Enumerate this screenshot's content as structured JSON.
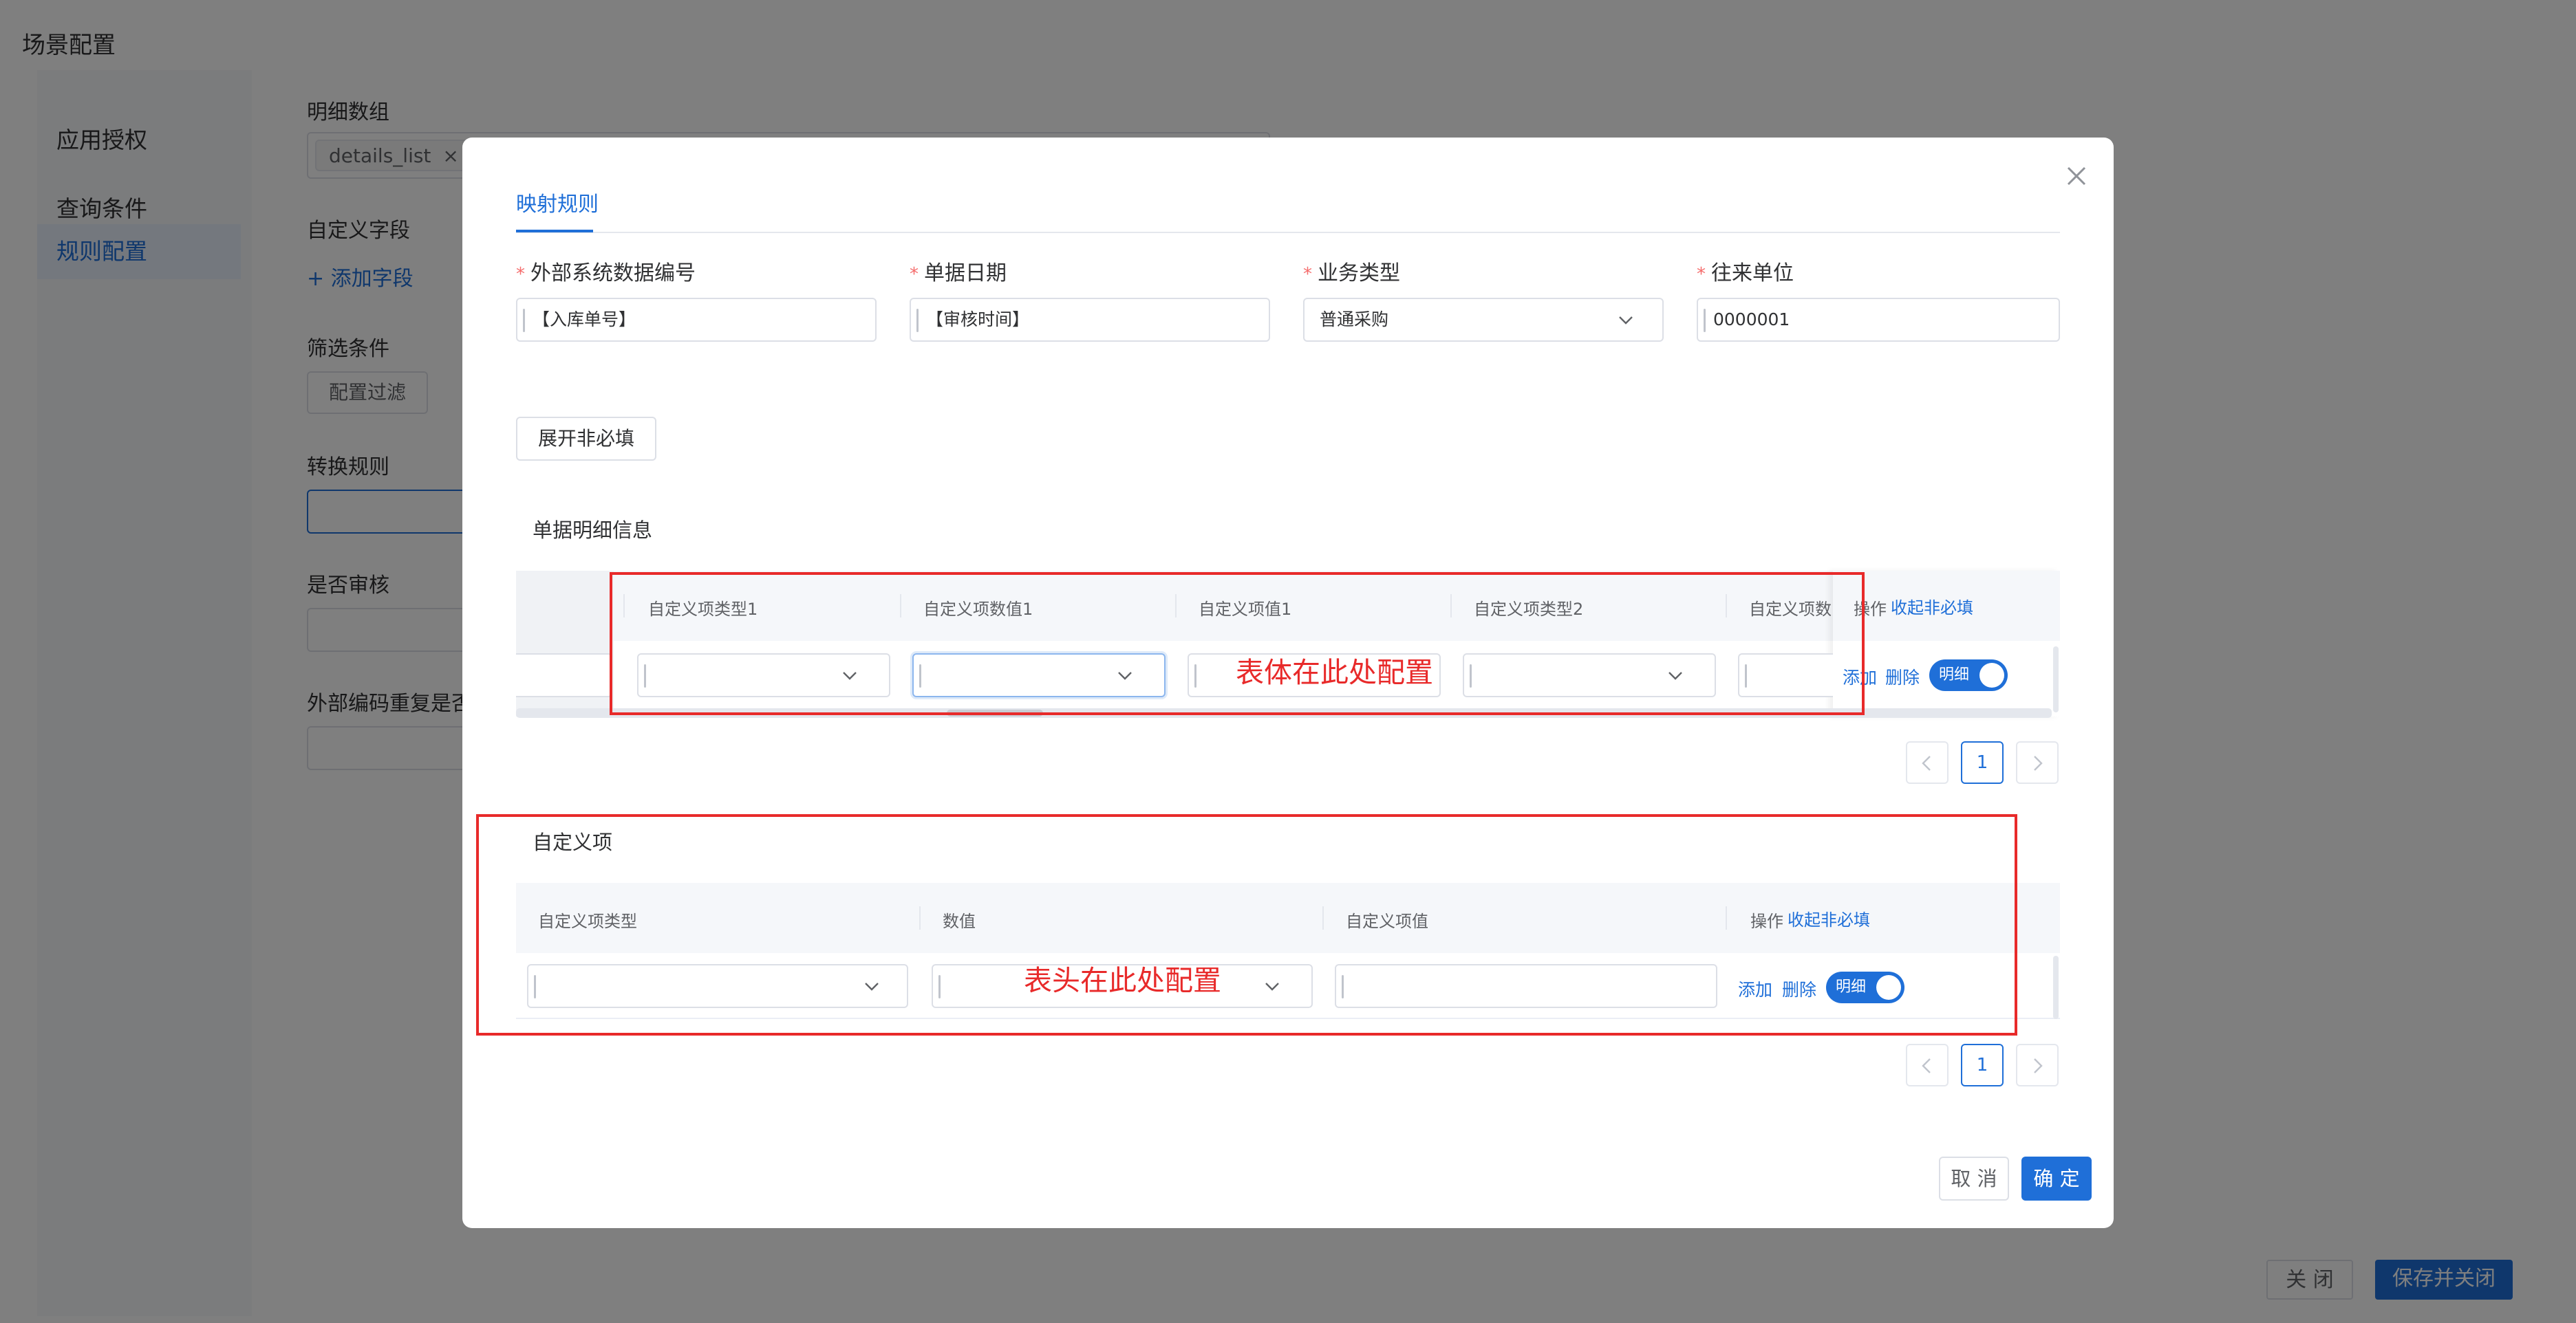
{
  "page": {
    "title": "场景配置",
    "nav": [
      "应用授权",
      "查询条件",
      "规则配置"
    ],
    "form": {
      "details_label": "明细数组",
      "details_tag": "details_list",
      "tag_close": "×",
      "custom_field_label": "自定义字段",
      "add_field": "+ 添加字段",
      "filter_label": "筛选条件",
      "filter_button": "配置过滤",
      "convert_label": "转换规则",
      "audit_label": "是否审核",
      "dup_label": "外部编码重复是否"
    },
    "footer": {
      "close": "关 闭",
      "save_close": "保存并关闭"
    }
  },
  "dialog": {
    "tab": "映射规则",
    "fields": [
      {
        "label": "外部系统数据编号",
        "value": "【入库单号】",
        "required": true
      },
      {
        "label": "单据日期",
        "value": "【审核时间】",
        "required": true
      },
      {
        "label": "业务类型",
        "value": "普通采购",
        "required": true
      },
      {
        "label": "往来单位",
        "value": "0000001",
        "required": true
      }
    ],
    "required_mark": "*",
    "expand_button": "展开非必填",
    "body_section": {
      "title": "单据明细信息",
      "columns": [
        "自定义项类型1",
        "自定义项数值1",
        "自定义项值1",
        "自定义项类型2",
        "自定义项数"
      ],
      "op_label": "操作",
      "collapse_link": "收起非必填",
      "add": "添加",
      "delete": "删除",
      "toggle": "明细",
      "annotation": "表体在此处配置",
      "page": "1"
    },
    "header_section": {
      "title": "自定义项",
      "columns": [
        "自定义项类型",
        "数值",
        "自定义项值"
      ],
      "op_label": "操作",
      "collapse_link": "收起非必填",
      "add": "添加",
      "delete": "删除",
      "toggle": "明细",
      "annotation": "表头在此处配置",
      "page": "1"
    },
    "cancel": "取 消",
    "confirm": "确 定"
  },
  "colors": {
    "accent": "#1f6fd8",
    "annotation": "#e82a2a",
    "required": "#f56c6c"
  }
}
